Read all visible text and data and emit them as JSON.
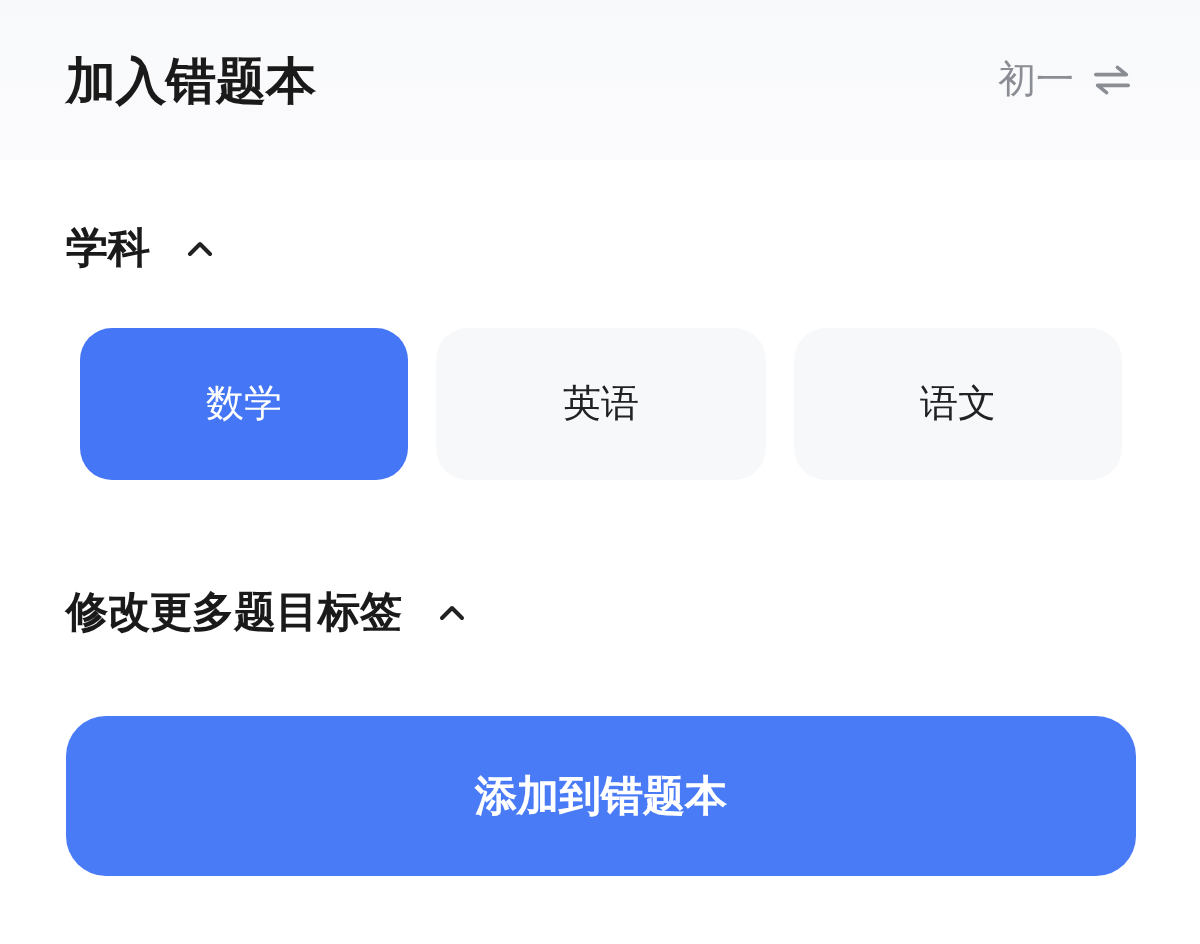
{
  "header": {
    "title": "加入错题本",
    "grade": "初一"
  },
  "subject_section": {
    "label": "学科",
    "expanded": true
  },
  "subjects": [
    {
      "label": "数学",
      "selected": true
    },
    {
      "label": "英语",
      "selected": false
    },
    {
      "label": "语文",
      "selected": false
    }
  ],
  "tags_section": {
    "label": "修改更多题目标签",
    "expanded": true
  },
  "submit_button": "添加到错题本"
}
